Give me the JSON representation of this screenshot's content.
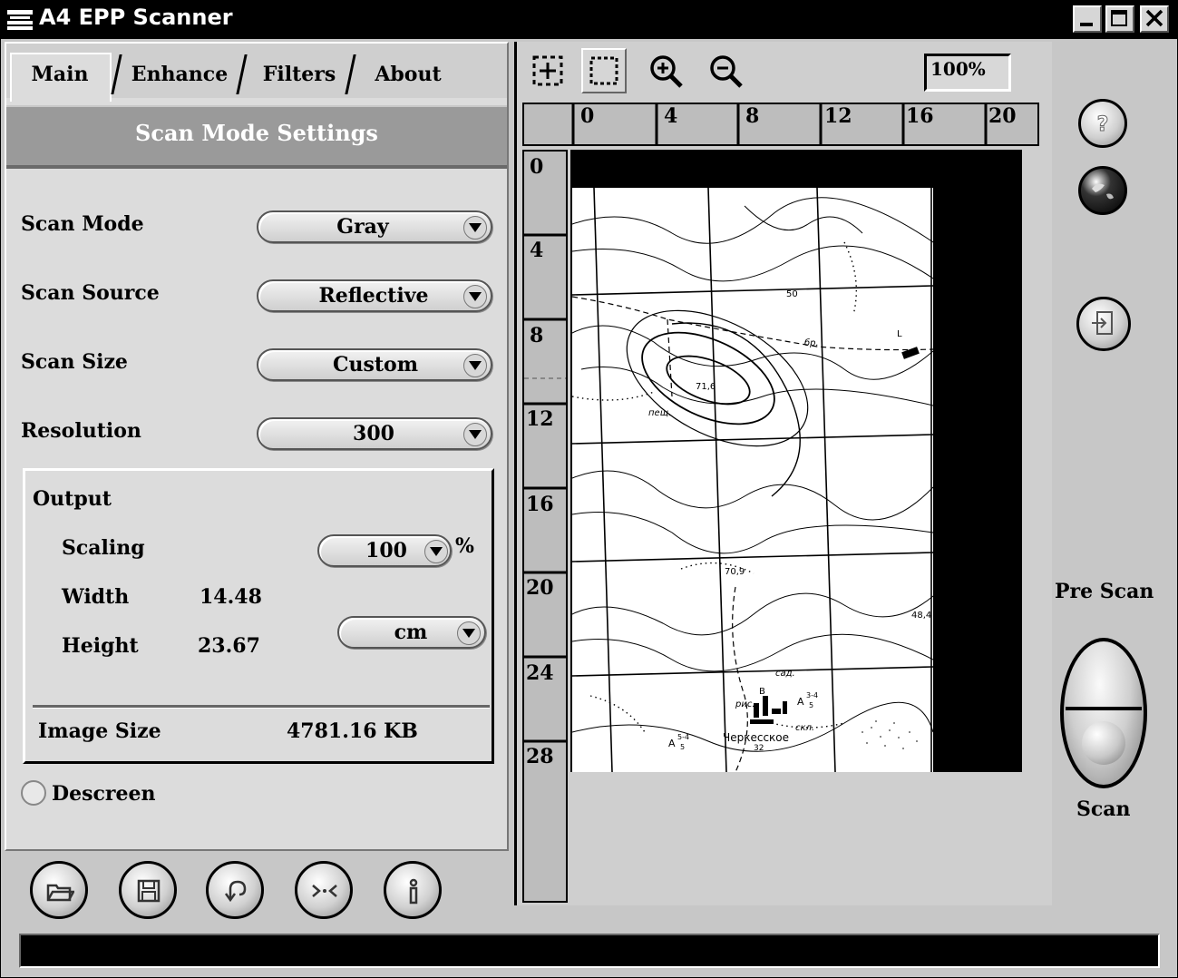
{
  "window": {
    "title": "A4 EPP Scanner",
    "controls": [
      "minimize-icon",
      "maximize-icon",
      "close-icon"
    ]
  },
  "tabs": [
    {
      "label": "Main",
      "active": true
    },
    {
      "label": "Enhance",
      "active": false
    },
    {
      "label": "Filters",
      "active": false
    },
    {
      "label": "About",
      "active": false
    }
  ],
  "section_header": "Scan Mode Settings",
  "settings": {
    "scan_mode": {
      "label": "Scan Mode",
      "value": "Gray"
    },
    "scan_source": {
      "label": "Scan Source",
      "value": "Reflective"
    },
    "scan_size": {
      "label": "Scan Size",
      "value": "Custom"
    },
    "resolution": {
      "label": "Resolution",
      "value": "300"
    }
  },
  "output": {
    "title": "Output",
    "scaling_label": "Scaling",
    "scaling_value": "100",
    "scaling_unit": "%",
    "width_label": "Width",
    "width_value": "14.48",
    "height_label": "Height",
    "height_value": "23.67",
    "unit_value": "cm",
    "image_size_label": "Image Size",
    "image_size_value": "4781.16 KB"
  },
  "descreen": {
    "label": "Descreen",
    "checked": false
  },
  "bottom_toolbar": [
    "open-icon",
    "save-icon",
    "undo-icon",
    "reset-icon",
    "info-icon"
  ],
  "preview_toolbar": {
    "tools": [
      "auto-crop-icon",
      "marquee-select-icon",
      "zoom-in-icon",
      "zoom-out-icon"
    ],
    "zoom": "100%"
  },
  "ruler": {
    "horizontal": [
      "0",
      "4",
      "8",
      "12",
      "16",
      "20"
    ],
    "vertical": [
      "0",
      "4",
      "8",
      "12",
      "16",
      "20",
      "24",
      "28"
    ]
  },
  "map_labels": {
    "contour_50": "50",
    "elev_71": "71,6",
    "pesh": "пещ.",
    "br": "бр.",
    "l": "L",
    "elev_70": "70,9",
    "elev_48": "48,4",
    "sad": "сад.",
    "ris": "рис.",
    "skl": "скл.",
    "town": "Черкесское",
    "town_num": "32",
    "a1": "A",
    "a1_frac": "5-4",
    "a1_den": "5",
    "a2": "A",
    "a2_frac": "3-4",
    "a2_den": "5",
    "b": "B"
  },
  "side_buttons": [
    "help-icon",
    "globe-icon",
    "exit-icon"
  ],
  "prescan_label": "Pre Scan",
  "scan_label": "Scan",
  "colors": {
    "title_bar": "#000000",
    "panel": "#dcdcdc",
    "header_band": "#9a9a9a",
    "status_bar": "#000000"
  }
}
